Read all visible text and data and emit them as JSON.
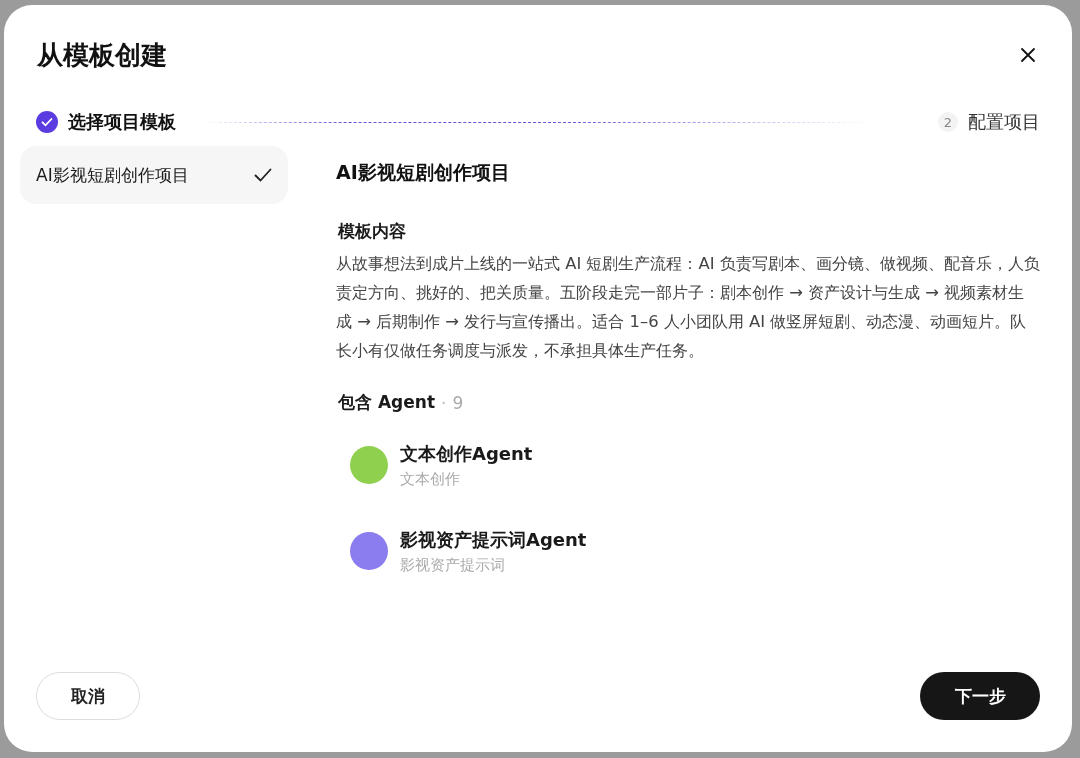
{
  "dialog": {
    "title": "从模板创建"
  },
  "steps": [
    {
      "label": "选择项目模板",
      "completed": true,
      "selected": true
    },
    {
      "number": "2",
      "label": "配置项目",
      "completed": false,
      "selected": false
    }
  ],
  "templates": [
    {
      "label": "AI影视短剧创作项目",
      "selected": true
    }
  ],
  "detail": {
    "title": "AI影视短剧创作项目",
    "section_heading": "模板内容",
    "description": "从故事想法到成片上线的一站式 AI 短剧生产流程：AI 负责写剧本、画分镜、做视频、配音乐，人负责定方向、挑好的、把关质量。五阶段走完一部片子：剧本创作 → 资产设计与生成 → 视频素材生成 → 后期制作 → 发行与宣传播出。适合 1–6 人小团队用 AI 做竖屏短剧、动态漫、动画短片。队长小有仅做任务调度与派发，不承担具体生产任务。",
    "agents_heading": "包含 Agent",
    "agents_separator": "·",
    "agents_count": "9",
    "agents": [
      {
        "name": "文本创作Agent",
        "role": "文本创作",
        "color": "#8fd14f"
      },
      {
        "name": "影视资产提示词Agent",
        "role": "影视资产提示词",
        "color": "#8b7cf0"
      }
    ]
  },
  "buttons": {
    "cancel": "取消",
    "next": "下一步"
  }
}
